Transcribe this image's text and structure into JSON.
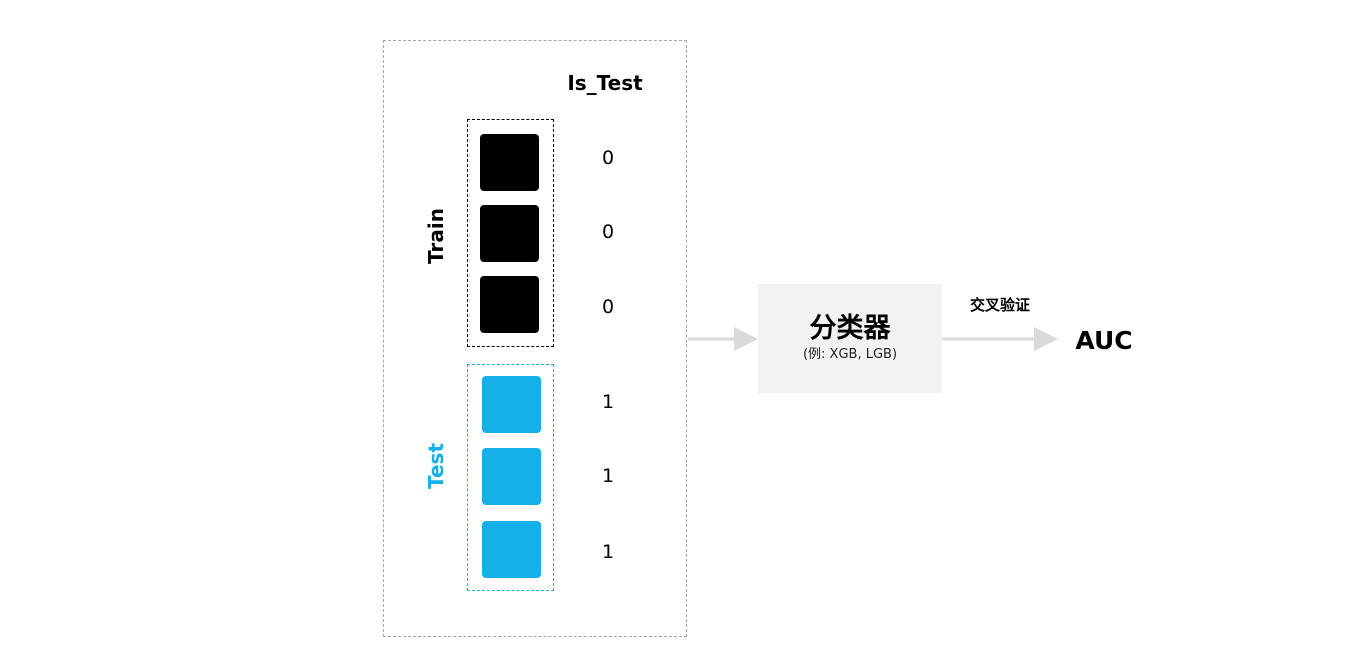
{
  "column_header": "Is_Test",
  "train_group": {
    "label": "Train",
    "values": [
      "0",
      "0",
      "0"
    ],
    "color": "#000000"
  },
  "test_group": {
    "label": "Test",
    "values": [
      "1",
      "1",
      "1"
    ],
    "color": "#15b0e8"
  },
  "classifier": {
    "title": "分类器",
    "subtitle": "(例: XGB, LGB)"
  },
  "cross_validation_label": "交叉验证",
  "output_label": "AUC",
  "colors": {
    "arrow": "#d9d9d9",
    "classifier_bg": "#f2f2f2",
    "outer_border": "#a6a6a6"
  }
}
